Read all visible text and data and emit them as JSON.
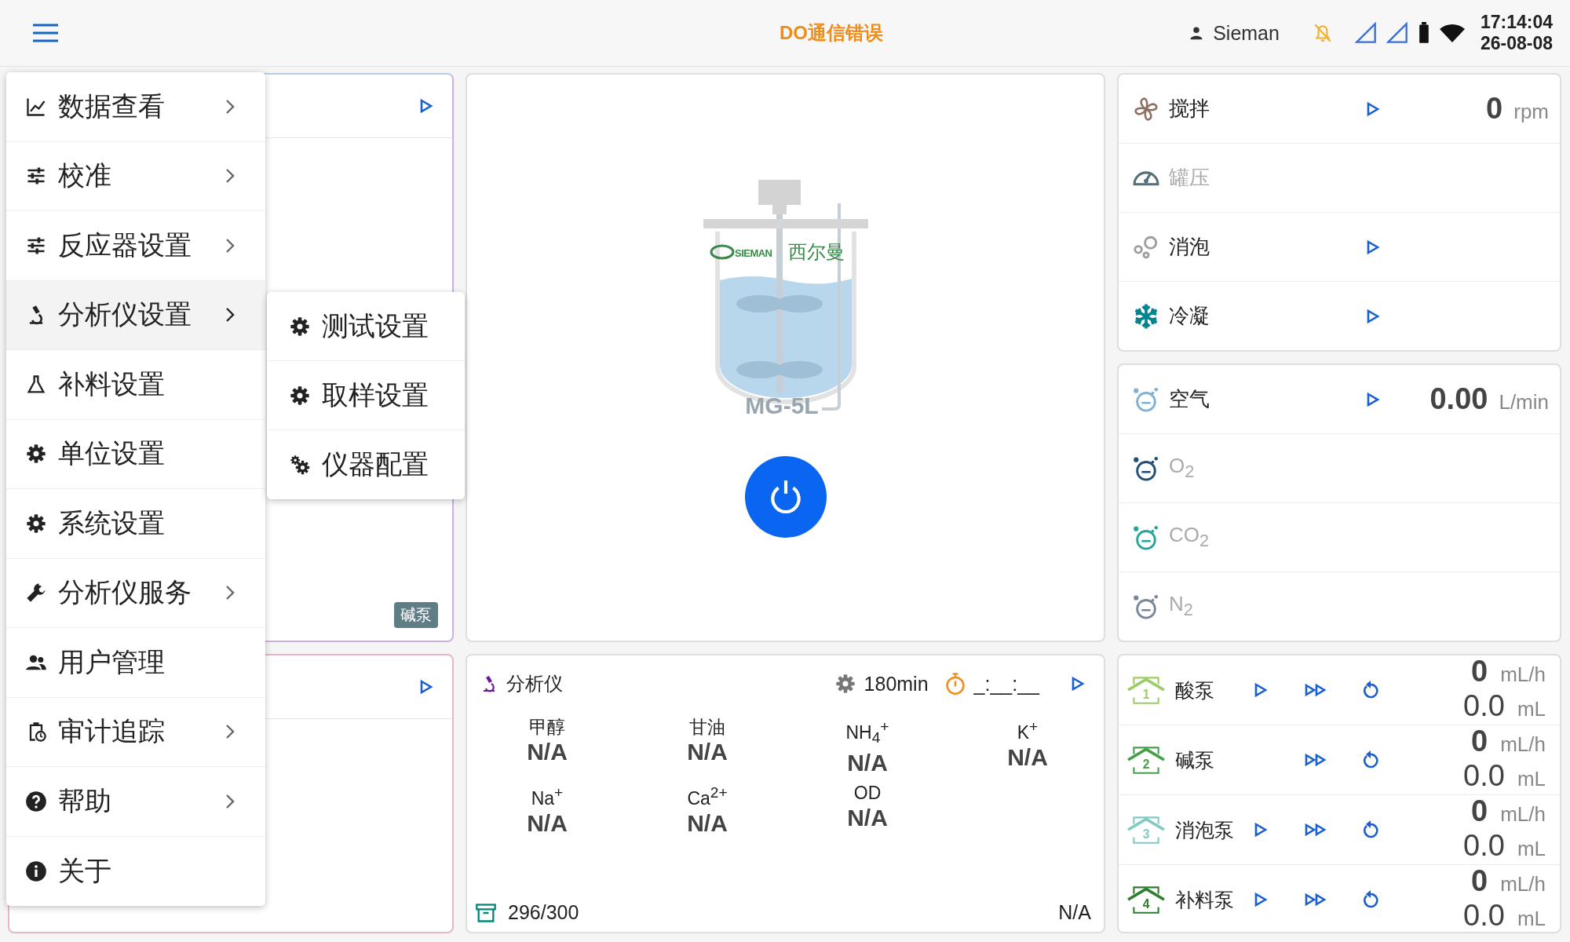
{
  "status_bar": {
    "title": "DO通信错误",
    "user": "Sieman",
    "time": "17:14:04",
    "date": "26-08-08"
  },
  "menu": {
    "items": [
      {
        "label": "数据查看",
        "has_submenu": true,
        "selected": false
      },
      {
        "label": "校准",
        "has_submenu": true,
        "selected": false
      },
      {
        "label": "反应器设置",
        "has_submenu": true,
        "selected": false
      },
      {
        "label": "分析仪设置",
        "has_submenu": true,
        "selected": true
      },
      {
        "label": "补料设置",
        "has_submenu": false,
        "selected": false
      },
      {
        "label": "单位设置",
        "has_submenu": false,
        "selected": false
      },
      {
        "label": "系统设置",
        "has_submenu": false,
        "selected": false
      },
      {
        "label": "分析仪服务",
        "has_submenu": true,
        "selected": false
      },
      {
        "label": "用户管理",
        "has_submenu": false,
        "selected": false
      },
      {
        "label": "审计追踪",
        "has_submenu": true,
        "selected": false
      },
      {
        "label": "帮助",
        "has_submenu": true,
        "selected": false
      },
      {
        "label": "关于",
        "has_submenu": false,
        "selected": false
      }
    ]
  },
  "submenu": {
    "items": [
      {
        "label": "测试设置"
      },
      {
        "label": "取样设置"
      },
      {
        "label": "仪器配置"
      }
    ]
  },
  "left_card": {
    "badge": "碱泵"
  },
  "reactor": {
    "brand": "SIEMAN",
    "brand_cn": "西尔曼",
    "model": "MG-5L"
  },
  "analyzer": {
    "title": "分析仪",
    "interval": "180min",
    "timer": "_:__:__",
    "count": "296/300",
    "status": "N/A",
    "readings": [
      {
        "name": "甲醇",
        "value": "N/A"
      },
      {
        "name": "甘油",
        "value": "N/A"
      },
      {
        "name": "NH$_{4}$$^{+}$",
        "value": "N/A"
      },
      {
        "name": "K$^{+}$",
        "value": "N/A"
      },
      {
        "name": "Na$^{+}$",
        "value": "N/A"
      },
      {
        "name": "Ca$^{2+}$",
        "value": "N/A"
      },
      {
        "name": "OD",
        "value": "N/A"
      }
    ]
  },
  "controls": [
    {
      "label": "搅拌",
      "disabled": false,
      "play": true,
      "value": "0",
      "unit": "rpm"
    },
    {
      "label": "罐压",
      "disabled": true,
      "play": false
    },
    {
      "label": "消泡",
      "disabled": false,
      "play": true
    },
    {
      "label": "冷凝",
      "disabled": false,
      "play": true
    }
  ],
  "gases": [
    {
      "label": "空气",
      "disabled": false,
      "play": true,
      "value": "0.00",
      "unit": "L/min"
    },
    {
      "label": "O$_{2}$",
      "disabled": true,
      "play": false
    },
    {
      "label": "CO$_{2}$",
      "disabled": true,
      "play": false
    },
    {
      "label": "N$_{2}$",
      "disabled": true,
      "play": false
    }
  ],
  "pumps": [
    {
      "label": "酸泵",
      "number": "1",
      "color": "#9ccc65",
      "play": true,
      "rate": "0",
      "rate_unit": "mL/h",
      "volume": "0.0",
      "volume_unit": "mL"
    },
    {
      "label": "碱泵",
      "number": "2",
      "color": "#43a047",
      "play": false,
      "rate": "0",
      "rate_unit": "mL/h",
      "volume": "0.0",
      "volume_unit": "mL"
    },
    {
      "label": "消泡泵",
      "number": "3",
      "color": "#80cbc4",
      "play": true,
      "rate": "0",
      "rate_unit": "mL/h",
      "volume": "0.0",
      "volume_unit": "mL"
    },
    {
      "label": "补料泵",
      "number": "4",
      "color": "#2e7d32",
      "play": true,
      "rate": "0",
      "rate_unit": "mL/h",
      "volume": "0.0",
      "volume_unit": "mL"
    }
  ]
}
